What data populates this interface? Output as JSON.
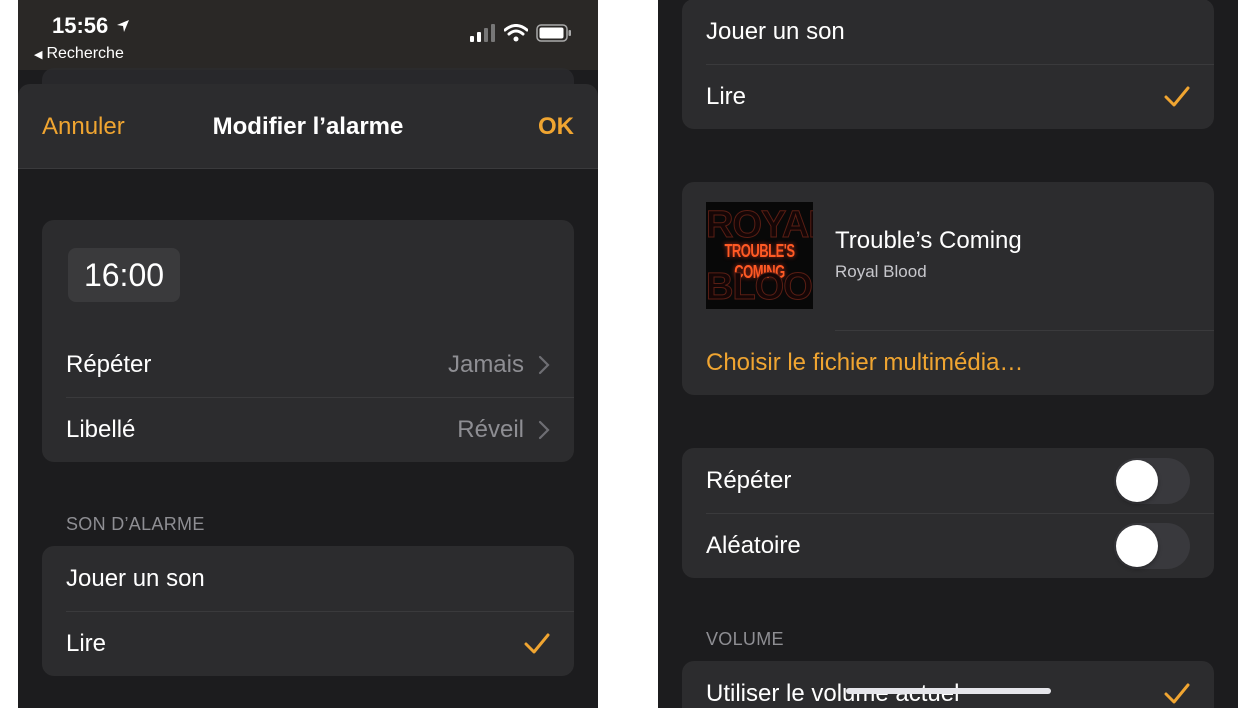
{
  "left": {
    "status": {
      "time": "15:56",
      "back_label": "Recherche"
    },
    "nav": {
      "cancel": "Annuler",
      "title": "Modifier l’alarme",
      "ok": "OK"
    },
    "time_value": "16:00",
    "rows": {
      "repeat": {
        "label": "Répéter",
        "value": "Jamais"
      },
      "label": {
        "label": "Libellé",
        "value": "Réveil"
      }
    },
    "sound_header": "SON D’ALARME",
    "sound_rows": {
      "play_sound": "Jouer un son",
      "read": "Lire"
    }
  },
  "right": {
    "sound_rows": {
      "play_sound": "Jouer un son",
      "read": "Lire"
    },
    "media": {
      "song_title": "Trouble’s Coming",
      "artist": "Royal Blood",
      "album_art_text": {
        "top": "ROYAL",
        "middle": "TROUBLE'S COMING",
        "bottom": "BLOOD"
      },
      "choose_link": "Choisir le fichier multimédia…"
    },
    "toggles": {
      "repeat": {
        "label": "Répéter",
        "on": false
      },
      "shuffle": {
        "label": "Aléatoire",
        "on": false
      }
    },
    "volume_header": "VOLUME",
    "volume_row": "Utiliser le volume actuel"
  },
  "colors": {
    "accent": "#f0a531",
    "background": "#1c1c1e",
    "group": "#2c2c2e"
  }
}
